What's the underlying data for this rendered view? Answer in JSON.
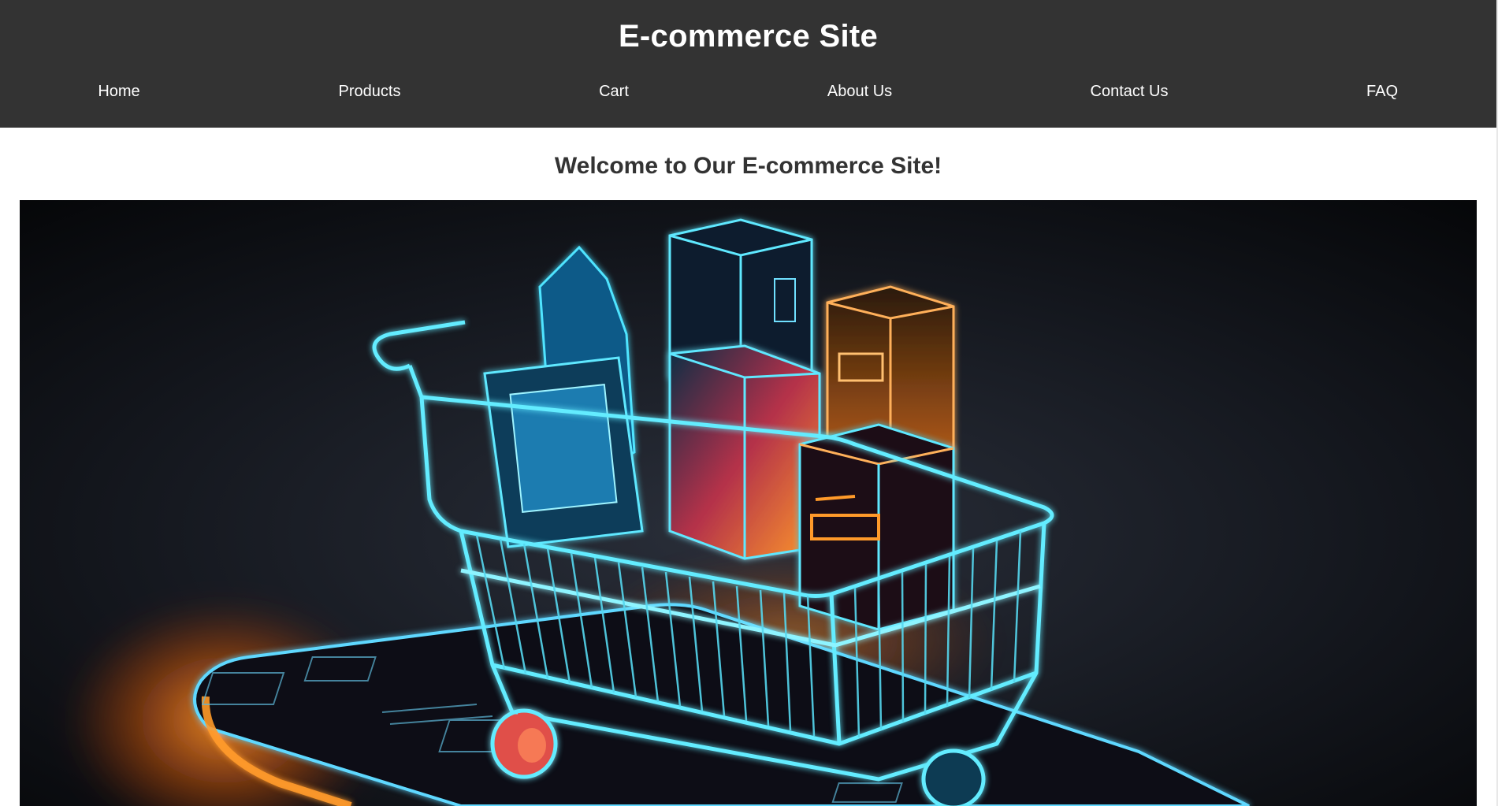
{
  "header": {
    "title": "E-commerce Site",
    "nav": [
      "Home",
      "Products",
      "Cart",
      "About Us",
      "Contact Us",
      "FAQ"
    ]
  },
  "main": {
    "heading": "Welcome to Our E-commerce Site!",
    "hero_image": "neon-shopping-cart-illustration"
  },
  "colors": {
    "header_bg": "#333333",
    "header_text": "#ffffff",
    "heading_text": "#333333",
    "neon_cyan": "#3fe6ff",
    "neon_orange": "#ff8a1f"
  }
}
